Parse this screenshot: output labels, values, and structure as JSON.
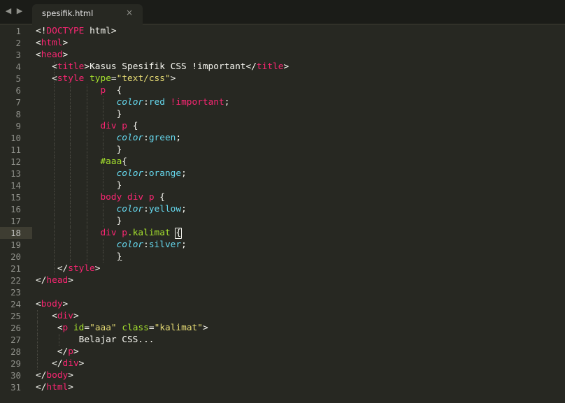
{
  "tabbar": {
    "nav_left_icon": "◀",
    "nav_right_icon": "▶",
    "tab_label": "spesifik.html",
    "tab_close": "×"
  },
  "editor": {
    "current_line": 18,
    "lines": [
      [
        [
          "t-white",
          "<!"
        ],
        [
          "t-pink",
          "DOCTYPE"
        ],
        [
          "t-white",
          " html>"
        ]
      ],
      [
        [
          "t-white",
          "<"
        ],
        [
          "t-pink",
          "html"
        ],
        [
          "t-white",
          ">"
        ]
      ],
      [
        [
          "t-white",
          "<"
        ],
        [
          "t-pink",
          "head"
        ],
        [
          "t-white",
          ">"
        ]
      ],
      [
        [
          "t-white",
          "   <"
        ],
        [
          "t-pink",
          "title"
        ],
        [
          "t-white",
          ">Kasus Spesifik CSS !important</"
        ],
        [
          "t-pink",
          "title"
        ],
        [
          "t-white",
          ">"
        ]
      ],
      [
        [
          "t-white",
          "   <"
        ],
        [
          "t-pink",
          "style"
        ],
        [
          "t-white",
          " "
        ],
        [
          "t-green",
          "type"
        ],
        [
          "t-white",
          "="
        ],
        [
          "t-yellow",
          "\"text/css\""
        ],
        [
          "t-white",
          ">"
        ]
      ],
      [
        [
          "t-white",
          "            "
        ],
        [
          "t-pink",
          "p"
        ],
        [
          "t-white",
          "  {"
        ]
      ],
      [
        [
          "t-white",
          "               "
        ],
        [
          "t-cyan-i",
          "color"
        ],
        [
          "t-white",
          ":"
        ],
        [
          "t-cyan",
          "red"
        ],
        [
          "t-white",
          " "
        ],
        [
          "t-pink",
          "!important"
        ],
        [
          "t-white",
          ";"
        ]
      ],
      [
        [
          "t-white",
          "               }"
        ]
      ],
      [
        [
          "t-white",
          "            "
        ],
        [
          "t-pink",
          "div"
        ],
        [
          "t-white",
          " "
        ],
        [
          "t-pink",
          "p"
        ],
        [
          "t-white",
          " {"
        ]
      ],
      [
        [
          "t-white",
          "               "
        ],
        [
          "t-cyan-i",
          "color"
        ],
        [
          "t-white",
          ":"
        ],
        [
          "t-cyan",
          "green"
        ],
        [
          "t-white",
          ";"
        ]
      ],
      [
        [
          "t-white",
          "               }"
        ]
      ],
      [
        [
          "t-white",
          "            "
        ],
        [
          "t-green",
          "#aaa"
        ],
        [
          "t-white",
          "{"
        ]
      ],
      [
        [
          "t-white",
          "               "
        ],
        [
          "t-cyan-i",
          "color"
        ],
        [
          "t-white",
          ":"
        ],
        [
          "t-cyan",
          "orange"
        ],
        [
          "t-white",
          ";"
        ]
      ],
      [
        [
          "t-white",
          "               }"
        ]
      ],
      [
        [
          "t-white",
          "            "
        ],
        [
          "t-pink",
          "body"
        ],
        [
          "t-white",
          " "
        ],
        [
          "t-pink",
          "div"
        ],
        [
          "t-white",
          " "
        ],
        [
          "t-pink",
          "p"
        ],
        [
          "t-white",
          " {"
        ]
      ],
      [
        [
          "t-white",
          "               "
        ],
        [
          "t-cyan-i",
          "color"
        ],
        [
          "t-white",
          ":"
        ],
        [
          "t-cyan",
          "yellow"
        ],
        [
          "t-white",
          ";"
        ]
      ],
      [
        [
          "t-white",
          "               }"
        ]
      ],
      [
        [
          "t-white",
          "            "
        ],
        [
          "t-pink",
          "div"
        ],
        [
          "t-white",
          " "
        ],
        [
          "t-pink",
          "p"
        ],
        [
          "t-green",
          ".kalimat"
        ],
        [
          "t-white",
          " "
        ],
        [
          "cursor",
          "{"
        ]
      ],
      [
        [
          "t-white",
          "               "
        ],
        [
          "t-cyan-i",
          "color"
        ],
        [
          "t-white",
          ":"
        ],
        [
          "t-cyan",
          "silver"
        ],
        [
          "t-white",
          ";"
        ]
      ],
      [
        [
          "t-white",
          "               "
        ],
        [
          "brace-u",
          "}"
        ]
      ],
      [
        [
          "t-white",
          "    </"
        ],
        [
          "t-pink",
          "style"
        ],
        [
          "t-white",
          ">"
        ]
      ],
      [
        [
          "t-white",
          "</"
        ],
        [
          "t-pink",
          "head"
        ],
        [
          "t-white",
          ">"
        ]
      ],
      [],
      [
        [
          "t-white",
          "<"
        ],
        [
          "t-pink",
          "body"
        ],
        [
          "t-white",
          ">"
        ]
      ],
      [
        [
          "t-white",
          "   <"
        ],
        [
          "t-pink",
          "div"
        ],
        [
          "t-white",
          ">"
        ]
      ],
      [
        [
          "t-white",
          "    <"
        ],
        [
          "t-pink",
          "p"
        ],
        [
          "t-white",
          " "
        ],
        [
          "t-green",
          "id"
        ],
        [
          "t-white",
          "="
        ],
        [
          "t-yellow",
          "\"aaa\""
        ],
        [
          "t-white",
          " "
        ],
        [
          "t-green",
          "class"
        ],
        [
          "t-white",
          "="
        ],
        [
          "t-yellow",
          "\"kalimat\""
        ],
        [
          "t-white",
          ">"
        ]
      ],
      [
        [
          "t-white",
          "        Belajar CSS..."
        ]
      ],
      [
        [
          "t-white",
          "    </"
        ],
        [
          "t-pink",
          "p"
        ],
        [
          "t-white",
          ">"
        ]
      ],
      [
        [
          "t-white",
          "   </"
        ],
        [
          "t-pink",
          "div"
        ],
        [
          "t-white",
          ">"
        ]
      ],
      [
        [
          "t-white",
          "</"
        ],
        [
          "t-pink",
          "body"
        ],
        [
          "t-white",
          ">"
        ]
      ],
      [
        [
          "t-white",
          "</"
        ],
        [
          "t-pink",
          "html"
        ],
        [
          "t-white",
          ">"
        ]
      ]
    ],
    "line_numbers": [
      "1",
      "2",
      "3",
      "4",
      "5",
      "6",
      "7",
      "8",
      "9",
      "10",
      "11",
      "12",
      "13",
      "14",
      "15",
      "16",
      "17",
      "18",
      "19",
      "20",
      "21",
      "22",
      "23",
      "24",
      "25",
      "26",
      "27",
      "28",
      "29",
      "30",
      "31"
    ]
  }
}
